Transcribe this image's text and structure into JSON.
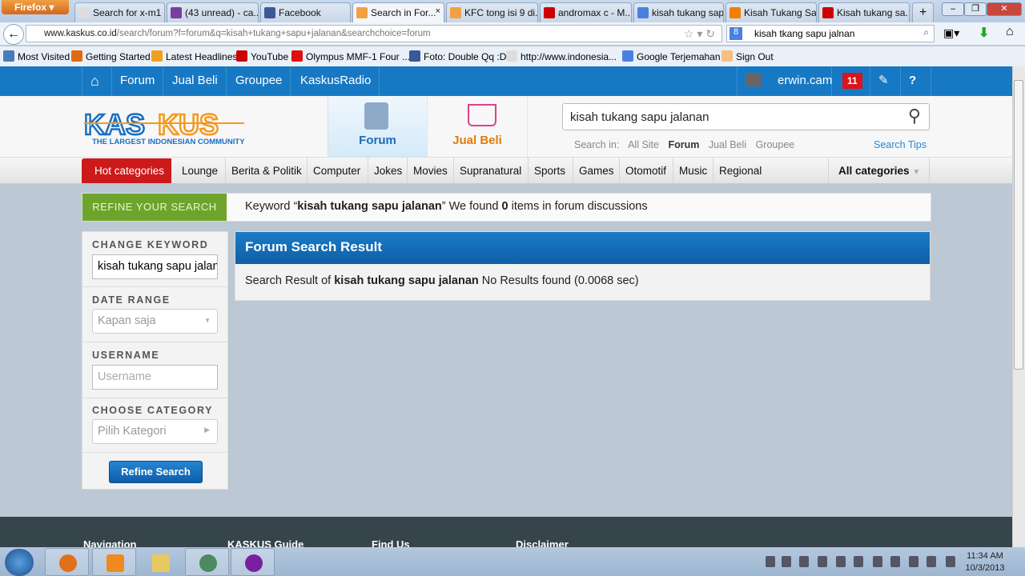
{
  "browser": {
    "menu_label": "Firefox",
    "tabs": [
      {
        "title": "Search for x-m1 ...",
        "color": "#ddd"
      },
      {
        "title": "(43 unread) - ca...",
        "color": "#7a3e9d"
      },
      {
        "title": "Facebook",
        "color": "#3b5998"
      },
      {
        "title": "Search in For...",
        "color": "#f3a040",
        "active": true
      },
      {
        "title": "KFC tong isi 9 di...",
        "color": "#f3a040"
      },
      {
        "title": "andromax c - M...",
        "color": "#c00"
      },
      {
        "title": "kisah tukang sap...",
        "color": "#4a80e0"
      },
      {
        "title": "Kisah Tukang Sa...",
        "color": "#f57d00"
      },
      {
        "title": "Kisah tukang sa...",
        "color": "#c00"
      }
    ],
    "new_tab": "+",
    "close_tab": "×",
    "url_domain": "www.kaskus.co.id",
    "url_path": "/search/forum?f=forum&q=kisah+tukang+sapu+jalanan&searchchoice=forum",
    "search_engine_value": "kisah tkang sapu jalnan",
    "bookmarks": [
      {
        "label": "Most Visited",
        "color": "#4a7ab8"
      },
      {
        "label": "Getting Started",
        "color": "#e06a10"
      },
      {
        "label": "Latest Headlines",
        "color": "#f0a020"
      },
      {
        "label": "YouTube",
        "color": "#c00"
      },
      {
        "label": "Olympus MMF-1 Four ...",
        "color": "#e01010"
      },
      {
        "label": "Foto: Double Qq :D",
        "color": "#3b5998"
      },
      {
        "label": "http://www.indonesia...",
        "color": "#ddd"
      },
      {
        "label": "Google Terjemahan",
        "color": "#4a80e0"
      },
      {
        "label": "Sign Out",
        "color": "#f3c080"
      }
    ]
  },
  "topnav": {
    "items": [
      "Forum",
      "Jual Beli",
      "Groupee",
      "KaskusRadio"
    ],
    "username": "erwin.cam",
    "notifications": "11"
  },
  "header": {
    "logo_text": "KASKUS",
    "logo_tagline": "THE LARGEST INDONESIAN COMMUNITY",
    "forum_tab": "Forum",
    "jualbeli_tab": "Jual Beli",
    "search_value": "kisah tukang sapu jalanan",
    "search_in_label": "Search in:",
    "search_in": [
      "All Site",
      "Forum",
      "Jual Beli",
      "Groupee"
    ],
    "search_in_active": "Forum",
    "search_tips": "Search Tips"
  },
  "categories": {
    "hot": "Hot categories",
    "items": [
      "Lounge",
      "Berita & Politik",
      "Computer",
      "Jokes",
      "Movies",
      "Supranatural",
      "Sports",
      "Games",
      "Otomotif",
      "Music",
      "Regional"
    ],
    "all": "All categories"
  },
  "refine": {
    "label": "REFINE YOUR SEARCH",
    "kw_prefix": "Keyword “",
    "keyword": "kisah tukang sapu jalanan",
    "kw_mid": "” We found ",
    "count": "0",
    "kw_suffix": " items in forum discussions"
  },
  "sidebar": {
    "change_keyword": "CHANGE KEYWORD",
    "keyword_value": "kisah tukang sapu jalanan",
    "date_range": "DATE RANGE",
    "date_value": "Kapan saja",
    "username": "USERNAME",
    "username_placeholder": "Username",
    "choose_category": "CHOOSE CATEGORY",
    "category_value": "Pilih Kategori",
    "button": "Refine Search"
  },
  "result": {
    "title": "Forum Search Result",
    "prefix": "Search Result of ",
    "keyword": "kisah tukang sapu jalanan",
    "suffix": " No Results found (0.0068 sec)"
  },
  "footer": {
    "headings": [
      "Navigation",
      "KASKUS Guide",
      "Find Us",
      "Disclaimer"
    ]
  },
  "taskbar": {
    "time": "11:34 AM",
    "date": "10/3/2013"
  }
}
